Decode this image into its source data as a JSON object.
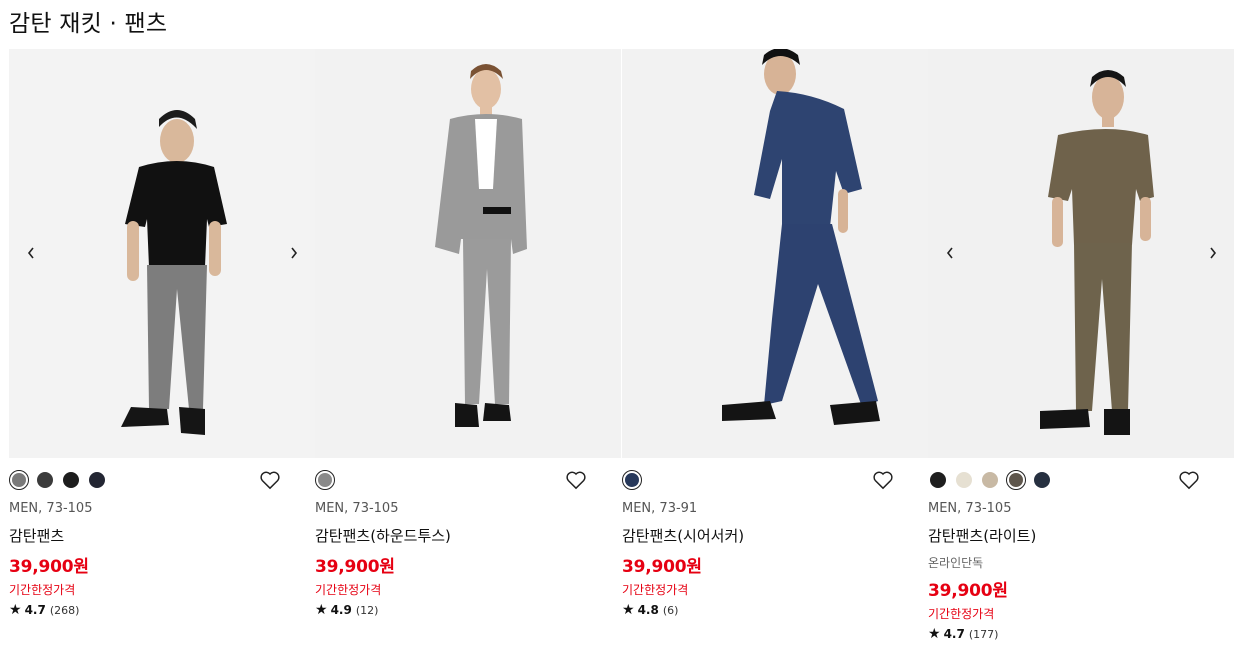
{
  "section": {
    "title": "감탄 재킷 · 팬츠"
  },
  "icons": {
    "prev": "chevron-left-icon",
    "next": "chevron-right-icon",
    "wishlist": "heart-icon",
    "star": "star-icon"
  },
  "products": [
    {
      "gender_size": "MEN, 73-105",
      "name": "감탄팬츠",
      "online_only": "",
      "price": "39,900원",
      "price_note": "기간한정가격",
      "star": "★",
      "rating": "4.7",
      "review_count": "(268)",
      "colors": [
        "#7a7a7a",
        "#3b3b3b",
        "#1d1d1d",
        "#232633"
      ],
      "selected_color": 0
    },
    {
      "gender_size": "MEN, 73-105",
      "name": "감탄팬츠(하운드투스)",
      "online_only": "",
      "price": "39,900원",
      "price_note": "기간한정가격",
      "star": "★",
      "rating": "4.9",
      "review_count": "(12)",
      "colors": [
        "#8a8a8a"
      ],
      "selected_color": 0
    },
    {
      "gender_size": "MEN, 73-91",
      "name": "감탄팬츠(시어서커)",
      "online_only": "",
      "price": "39,900원",
      "price_note": "기간한정가격",
      "star": "★",
      "rating": "4.8",
      "review_count": "(6)",
      "colors": [
        "#27385a"
      ],
      "selected_color": 0
    },
    {
      "gender_size": "MEN, 73-105",
      "name": "감탄팬츠(라이트)",
      "online_only": "온라인단독",
      "price": "39,900원",
      "price_note": "기간한정가격",
      "star": "★",
      "rating": "4.7",
      "review_count": "(177)",
      "colors": [
        "#1e1e1e",
        "#e6e0d2",
        "#c8b9a4",
        "#5e564c",
        "#263040"
      ],
      "selected_color": 3
    }
  ]
}
